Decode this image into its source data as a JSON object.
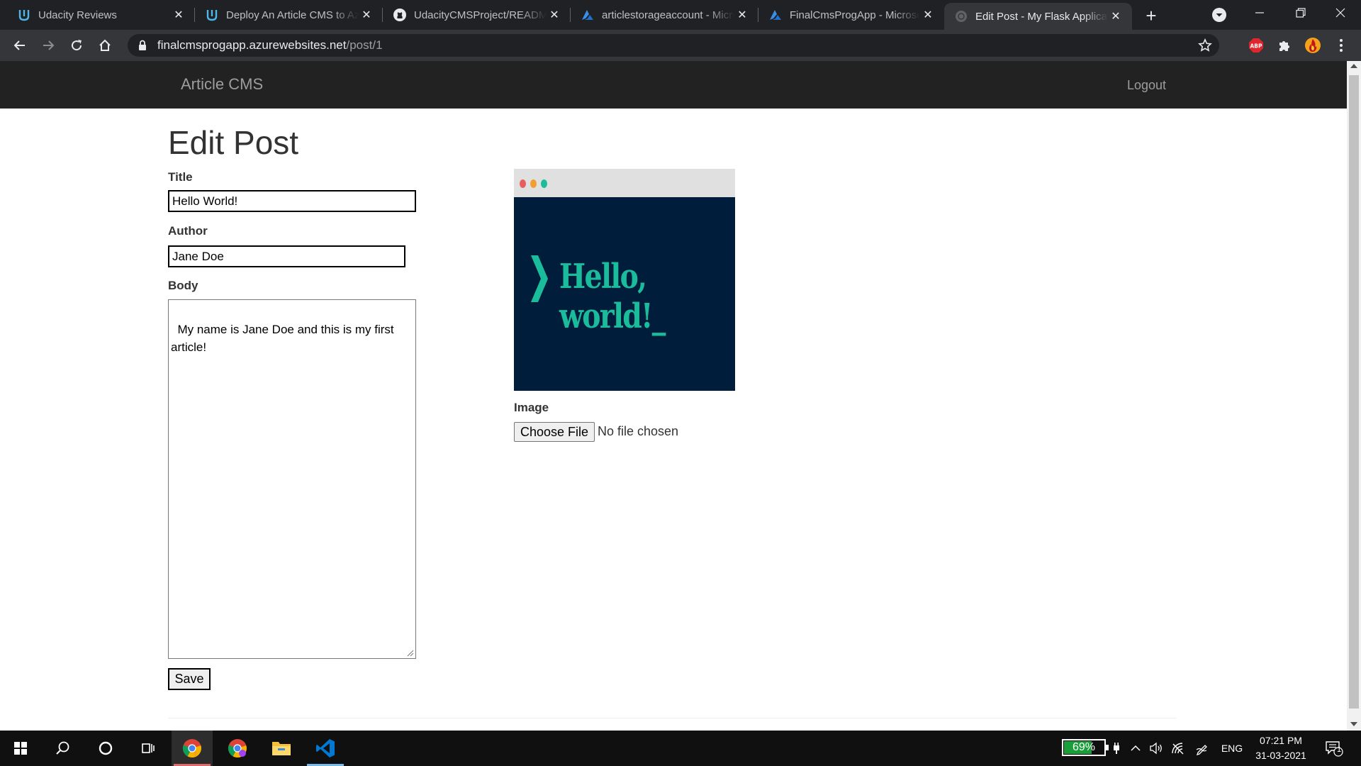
{
  "browser": {
    "tabs": [
      {
        "title": "Udacity Reviews",
        "icon": "udacity-icon"
      },
      {
        "title": "Deploy An Article CMS to Azure",
        "icon": "udacity-icon"
      },
      {
        "title": "UdacityCMSProject/README.md",
        "icon": "github-icon"
      },
      {
        "title": "articlestorageaccount - Microsoft Azure",
        "icon": "azure-icon"
      },
      {
        "title": "FinalCmsProgApp - Microsoft Azure",
        "icon": "azure-icon"
      },
      {
        "title": "Edit Post - My Flask Application",
        "icon": "globe-icon",
        "active": true
      }
    ],
    "url_host": "finalcmsprogapp.azurewebsites.net",
    "url_path": "/post/1",
    "extensions": [
      "adblock-icon",
      "puzzle-icon",
      "profile-avatar",
      "kebab-menu-icon"
    ]
  },
  "navbar": {
    "brand": "Article CMS",
    "logout": "Logout"
  },
  "form": {
    "heading": "Edit Post",
    "title_label": "Title",
    "title_value": "Hello World!",
    "author_label": "Author",
    "author_value": "Jane Doe",
    "body_label": "Body",
    "body_value": "My name is Jane Doe and this is my first\narticle!",
    "save_label": "Save"
  },
  "image": {
    "preview_text": "Hello, world!_",
    "label": "Image",
    "choose_label": "Choose File",
    "no_file_text": "No file chosen"
  },
  "taskbar": {
    "apps": [
      "windows-start-icon",
      "search-icon",
      "cortana-icon",
      "task-view-icon",
      "chrome-icon",
      "chrome-profile-icon",
      "file-explorer-icon",
      "vscode-icon"
    ],
    "battery_percent": "69%",
    "battery_level": 0.69,
    "language": "ENG",
    "time": "07:21 PM",
    "date": "31-03-2021",
    "notification_count": "1"
  },
  "colors": {
    "navbar_bg": "#222222",
    "preview_bg": "#001e3c",
    "preview_text": "#1bbc9b",
    "chrome_dark": "#202124",
    "taskbar_bg": "#101010"
  }
}
